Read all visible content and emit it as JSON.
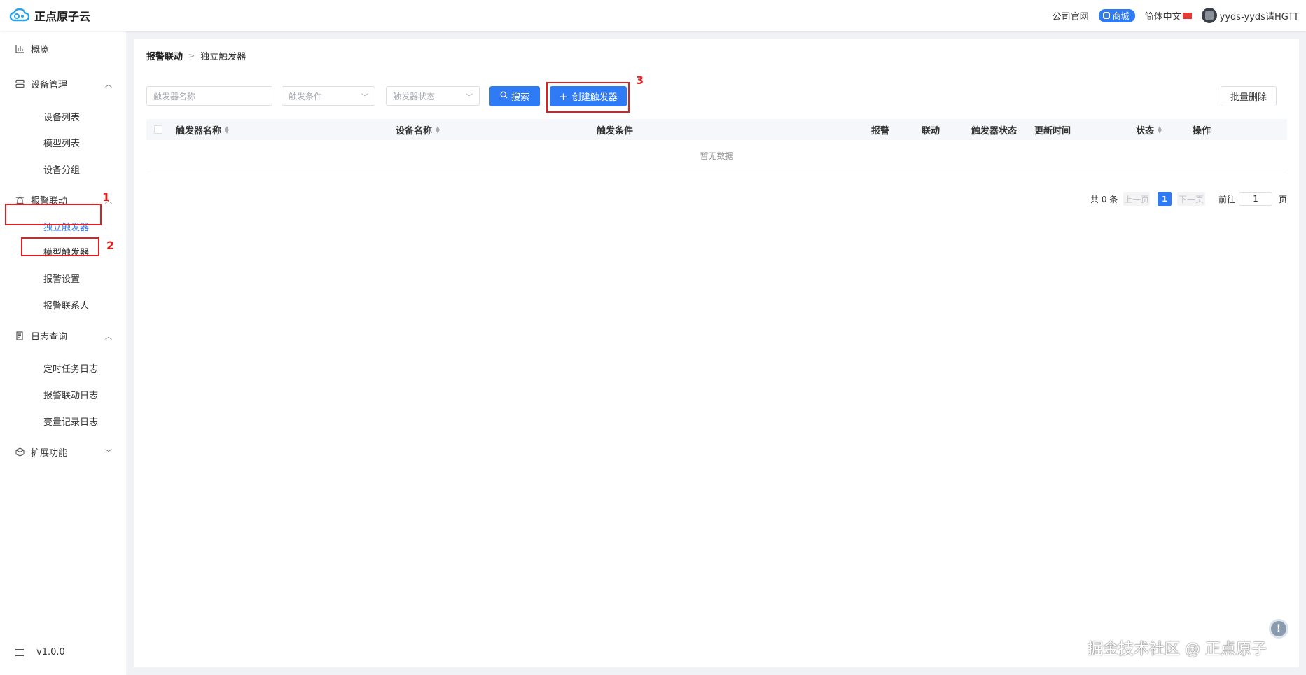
{
  "header": {
    "logo_text": "正点原子云",
    "links": {
      "company_site": "公司官网",
      "shop": "商城",
      "language": "简体中文",
      "username": "yyds-yyds请HGTT"
    }
  },
  "sidebar": {
    "overview": "概览",
    "device_mgmt": "设备管理",
    "device_list": "设备列表",
    "model_list": "模型列表",
    "device_group": "设备分组",
    "alarm_link": "报警联动",
    "independent_trigger": "独立触发器",
    "model_trigger": "模型触发器",
    "alarm_settings": "报警设置",
    "alarm_contacts": "报警联系人",
    "log_query": "日志查询",
    "scheduled_log": "定时任务日志",
    "alarm_link_log": "报警联动日志",
    "variable_log": "变量记录日志",
    "extensions": "扩展功能",
    "version": "v1.0.0"
  },
  "annotations": {
    "n1": "1",
    "n2": "2",
    "n3": "3"
  },
  "breadcrumb": {
    "parent": "报警联动",
    "current": "独立触发器"
  },
  "filters": {
    "name_placeholder": "触发器名称",
    "condition_placeholder": "触发条件",
    "status_placeholder": "触发器状态",
    "search_label": "搜索",
    "create_label": "创建触发器",
    "batch_delete_label": "批量删除"
  },
  "table": {
    "columns": [
      "触发器名称",
      "设备名称",
      "触发条件",
      "报警",
      "联动",
      "触发器状态",
      "更新时间",
      "状态",
      "操作"
    ],
    "empty_text": "暂无数据"
  },
  "pagination": {
    "total": "共 0 条",
    "prev": "上一页",
    "current": "1",
    "next": "下一页",
    "goto": "前往",
    "goto_value": "1",
    "page_unit": "页"
  },
  "watermark": "掘金技术社区 @ 正点原子",
  "help_label": "!"
}
